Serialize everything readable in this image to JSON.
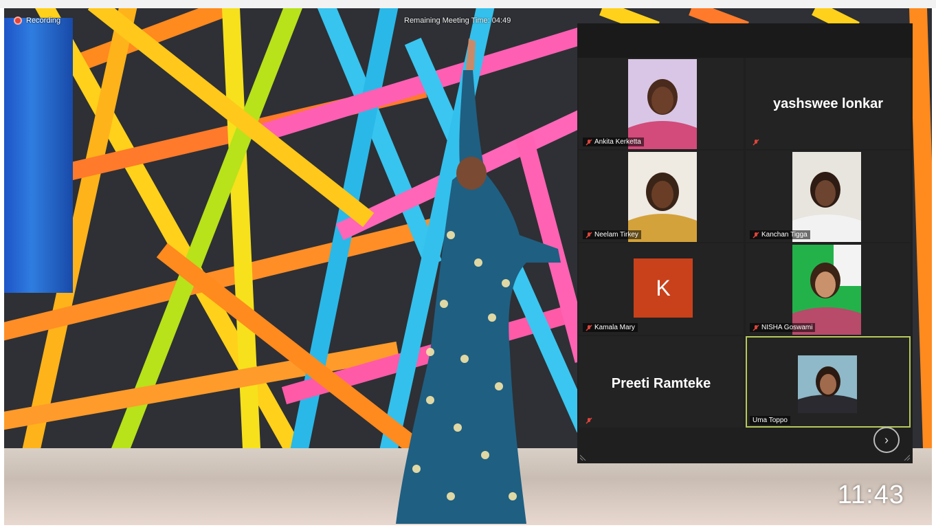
{
  "recording": {
    "label": "Recording"
  },
  "meeting": {
    "remaining_label": "Remaining Meeting Time: 04:49"
  },
  "clock": {
    "time": "11:43"
  },
  "gallery": {
    "participants": [
      {
        "name": "Ankita Kerketta",
        "display": "video",
        "muted": true
      },
      {
        "name": "yashswee lonkar",
        "display": "name",
        "muted": true
      },
      {
        "name": "Neelam Tirkey",
        "display": "video",
        "muted": true
      },
      {
        "name": "Kanchan Tigga",
        "display": "video",
        "muted": true
      },
      {
        "name": "Kamala Mary",
        "display": "avatar",
        "avatar_letter": "K",
        "avatar_color": "#c9411b",
        "muted": true
      },
      {
        "name": "NISHA Goswami",
        "display": "video",
        "muted": true
      },
      {
        "name": "Preeti Ramteke",
        "display": "name",
        "muted": true
      },
      {
        "name": "Uma Toppo",
        "display": "video",
        "muted": false,
        "active_speaker": true
      }
    ],
    "next_page_icon": "chevron-right-icon"
  },
  "colors": {
    "muted_icon": "#e0443a",
    "active_border": "#b6c95a",
    "gallery_bg": "#1f1f1f"
  }
}
